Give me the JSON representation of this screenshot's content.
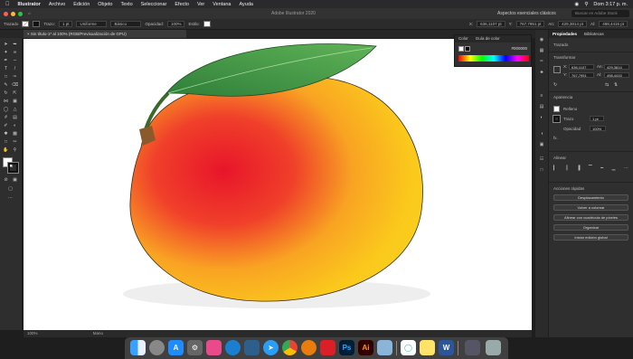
{
  "menubar": {
    "apple": "",
    "app": "Illustrator",
    "items": [
      "Archivo",
      "Edición",
      "Objeto",
      "Texto",
      "Seleccionar",
      "Efecto",
      "Ver",
      "Ventana",
      "Ayuda"
    ],
    "clock": "Dom 3:17 p. m."
  },
  "titlebar": {
    "title": "Adobe Illustrator 2020",
    "workspace": "Aspectos esenciales clásicos",
    "search_placeholder": "Buscar en Adobe Stock"
  },
  "controlbar": {
    "selection": "Trazado",
    "stroke_label": "Trazo:",
    "stroke_value": "1 pt",
    "profile": "Uniforme",
    "brush": "Básico",
    "opacity_label": "Opacidad:",
    "opacity_value": "100%",
    "style_label": "Estilo:",
    "x_label": "X:",
    "x_value": "636,1107 pt",
    "y_label": "Y:",
    "y_value": "767,7951 pt",
    "w_label": "An:",
    "w_value": "429,3814 pt",
    "h_label": "Al:",
    "h_value": "498,4415 pt"
  },
  "document": {
    "tab_label": "Sin título-1* al 100% (RGB/Previsualización de GPU)",
    "zoom": "100%",
    "status": "Mano"
  },
  "color_panel": {
    "tab_color": "Color",
    "tab_guide": "Guía de color",
    "hex_label": "#",
    "hex_value": "000000"
  },
  "properties": {
    "tab_props": "Propiedades",
    "tab_libs": "Bibliotecas",
    "selection_label": "Trazado",
    "transform_label": "Transformar",
    "x_label": "X:",
    "x": "636,1107",
    "y_label": "Y:",
    "y": "767,7951",
    "w_label": "An:",
    "w": "429,3814",
    "h_label": "Al:",
    "h": "498,4415",
    "appearance_label": "Apariencia",
    "fill_label": "Relleno",
    "stroke_label": "Trazo",
    "stroke_value": "1 pt",
    "opacity_label": "Opacidad",
    "opacity_value": "100%",
    "fx_label": "fx.",
    "align_label": "Alinear",
    "quick_actions_label": "Acciones rápidas",
    "btn_offset": "Desplazamiento",
    "btn_recolor": "Volver a colorear",
    "btn_align_grid": "Alinear con cuadrícula de píxeles",
    "btn_arrange": "Organizar",
    "btn_global_edit": "Iniciar edición global"
  },
  "colors": {
    "accent": "#2d8cff",
    "panel_bg": "#2f2f2f",
    "canvas_bg": "#ffffff"
  },
  "dock": {
    "apps": [
      "finder-icon",
      "launchpad-icon",
      "app-store-icon",
      "system-preferences-icon",
      "preview-icon",
      "edge-icon",
      "files-icon",
      "safari-icon",
      "chrome-icon",
      "blender-icon",
      "creative-cloud-icon",
      "photoshop-icon",
      "illustrator-icon",
      "preview-2-icon",
      "wondershare-icon",
      "notes-icon",
      "word-icon",
      "downloads-icon",
      "trash-icon"
    ],
    "ps": "Ps",
    "ai": "Ai",
    "w": "W"
  }
}
